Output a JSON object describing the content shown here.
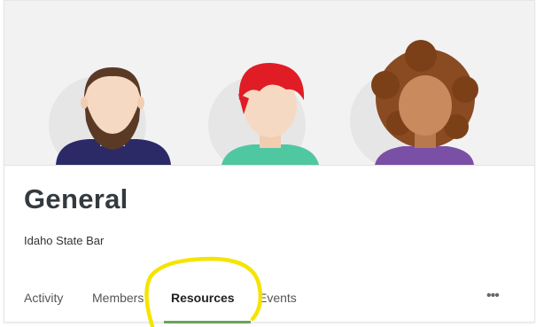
{
  "group": {
    "name": "General",
    "organization": "Idaho State Bar"
  },
  "tabs": [
    {
      "label": "Activity",
      "active": false
    },
    {
      "label": "Members",
      "active": false
    },
    {
      "label": "Resources",
      "active": true
    },
    {
      "label": "Events",
      "active": false
    }
  ],
  "more_menu": {
    "label": "•••",
    "icon": "more-horizontal-icon"
  },
  "colors": {
    "banner_bg": "#f2f2f2",
    "active_tab_underline": "#6aa35e",
    "annotation_highlight": "#f5e400",
    "title_text": "#333a40"
  }
}
